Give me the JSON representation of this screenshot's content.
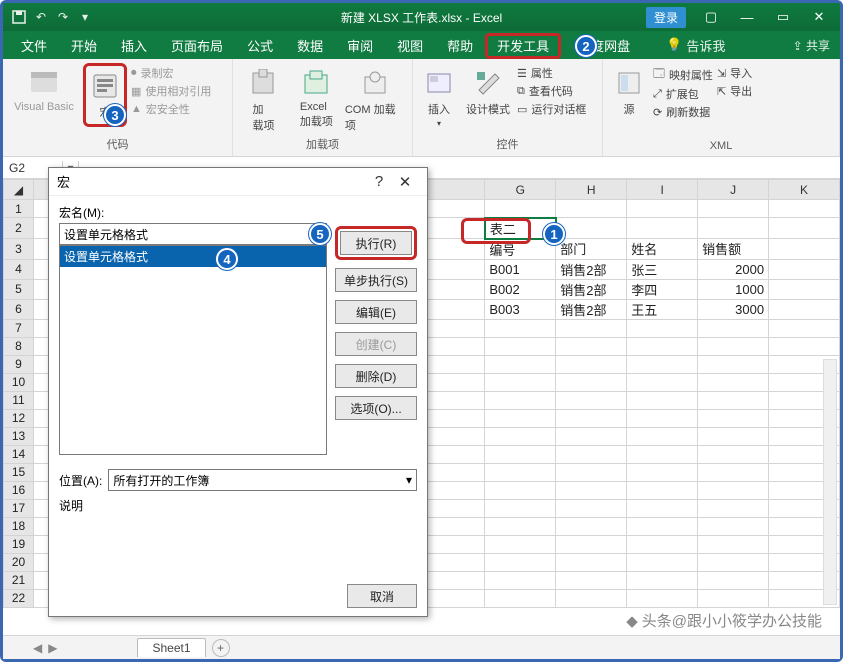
{
  "titlebar": {
    "title": "新建 XLSX 工作表.xlsx  -  Excel",
    "login": "登录"
  },
  "tabs": {
    "file": "文件",
    "home": "开始",
    "insert": "插入",
    "layout": "页面布局",
    "formula": "公式",
    "data": "数据",
    "review": "审阅",
    "view": "视图",
    "help": "帮助",
    "developer": "开发工具",
    "baidu": "度网盘",
    "tellme": "告诉我",
    "share": "共享"
  },
  "ribbon": {
    "code": {
      "vb": "Visual Basic",
      "macro": "宏",
      "record": "录制宏",
      "relref": "使用相对引用",
      "security": "宏安全性",
      "group": "代码"
    },
    "addins": {
      "addin": "加\n载项",
      "excel": "Excel\n加载项",
      "com": "COM 加载项",
      "group": "加载项"
    },
    "controls": {
      "insert": "插入",
      "design": "设计模式",
      "props": "属性",
      "viewcode": "查看代码",
      "rundlg": "运行对话框",
      "group": "控件"
    },
    "xml": {
      "source": "源",
      "mapprops": "映射属性",
      "expand": "扩展包",
      "refresh": "刷新数据",
      "import": "导入",
      "export": "导出",
      "group": "XML"
    }
  },
  "namebox": "G2",
  "sheet": {
    "cols": [
      "G",
      "H",
      "I",
      "J",
      "K"
    ],
    "g2": "表二",
    "hdr": {
      "g": "编号",
      "h": "部门",
      "i": "姓名",
      "j": "销售额"
    },
    "rows": [
      {
        "g": "B001",
        "h": "销售2部",
        "i": "张三",
        "j": "2000"
      },
      {
        "g": "B002",
        "h": "销售2部",
        "i": "李四",
        "j": "1000"
      },
      {
        "g": "B003",
        "h": "销售2部",
        "i": "王五",
        "j": "3000"
      }
    ]
  },
  "dialog": {
    "title": "宏",
    "name_label": "宏名(M):",
    "name_value": "设置单元格格式",
    "list_item": "设置单元格格式",
    "run": "执行(R)",
    "step": "单步执行(S)",
    "edit": "编辑(E)",
    "create": "创建(C)",
    "delete": "删除(D)",
    "options": "选项(O)...",
    "location_label": "位置(A):",
    "location_value": "所有打开的工作簿",
    "desc_label": "说明",
    "cancel": "取消"
  },
  "status": {
    "sheet": "Sheet1"
  },
  "watermark": "头条@跟小小筱学办公技能",
  "tags": {
    "1": "1",
    "2": "2",
    "3": "3",
    "4": "4",
    "5": "5"
  },
  "callouts": {
    "1_desc": "select Table 2 cell G2",
    "2_desc": "Developer tab",
    "3_desc": "Macros button",
    "4_desc": "macro list selection",
    "5_desc": "macro name then Run"
  }
}
